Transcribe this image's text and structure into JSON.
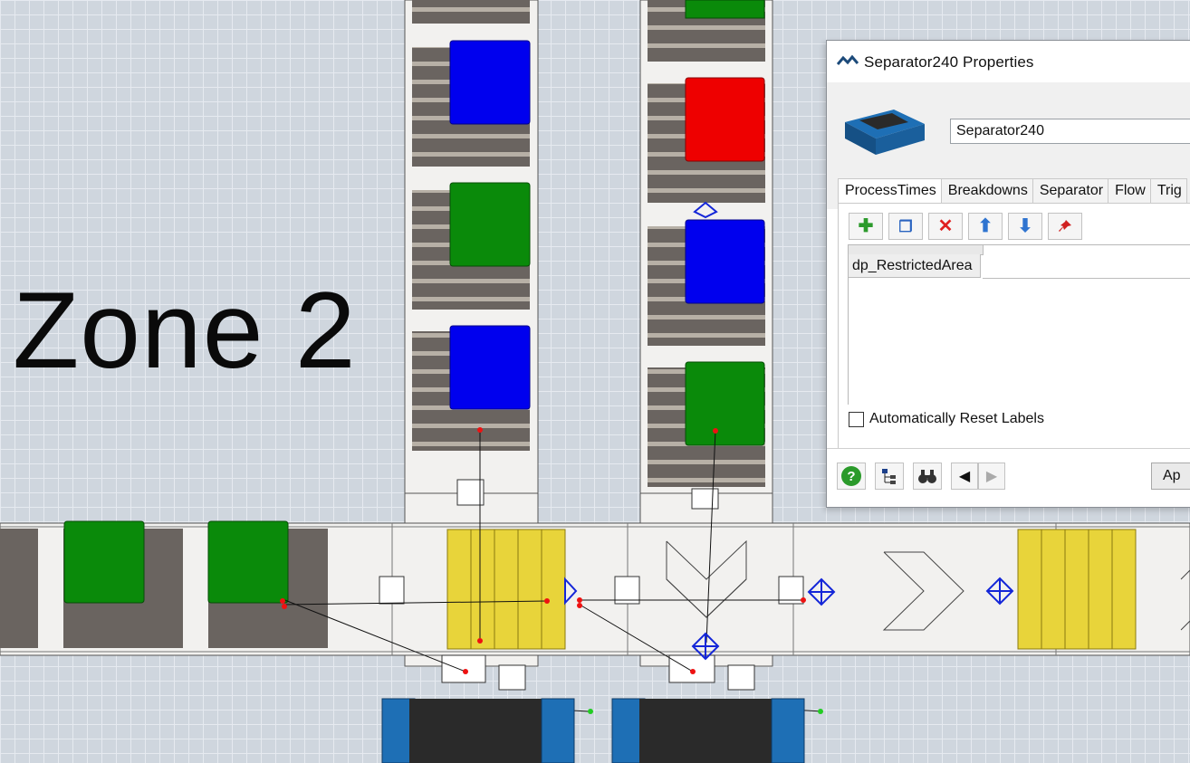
{
  "zone": {
    "label": "Zone 2"
  },
  "properties": {
    "window_title": "Separator240  Properties",
    "object_name": "Separator240",
    "tabs": [
      "ProcessTimes",
      "Breakdowns",
      "Separator",
      "Flow",
      "Trig"
    ],
    "active_tab_index": 0,
    "toolbar": [
      {
        "icon": "add-icon",
        "glyph": "✚",
        "color": "#2c9a2c"
      },
      {
        "icon": "copy-icon",
        "glyph": "❐",
        "color": "#2a64c0"
      },
      {
        "icon": "delete-icon",
        "glyph": "✕",
        "color": "#e02020"
      },
      {
        "icon": "move-up-icon",
        "glyph": "⬆",
        "color": "#2f74d0"
      },
      {
        "icon": "move-down-icon",
        "glyph": "⬇",
        "color": "#2f74d0"
      },
      {
        "icon": "pin-icon",
        "glyph": "📌",
        "color": "#d02020"
      }
    ],
    "label_row": "dp_RestrictedArea",
    "auto_reset": {
      "label": "Automatically Reset Labels",
      "checked": false
    },
    "footer": {
      "help_icon": "help-icon",
      "tree_icon": "tree-icon",
      "find_icon": "binoculars-icon",
      "apply_label": "Ap"
    }
  },
  "colors": {
    "box_blue": "#0000ee",
    "box_green": "#0a8a0a",
    "box_red": "#ee0000",
    "pallet_yellow": "#e8d43a",
    "pallet_wood": "#5a5450",
    "conveyor": "#f2f1ef",
    "marker_blue": "#1426d8"
  }
}
